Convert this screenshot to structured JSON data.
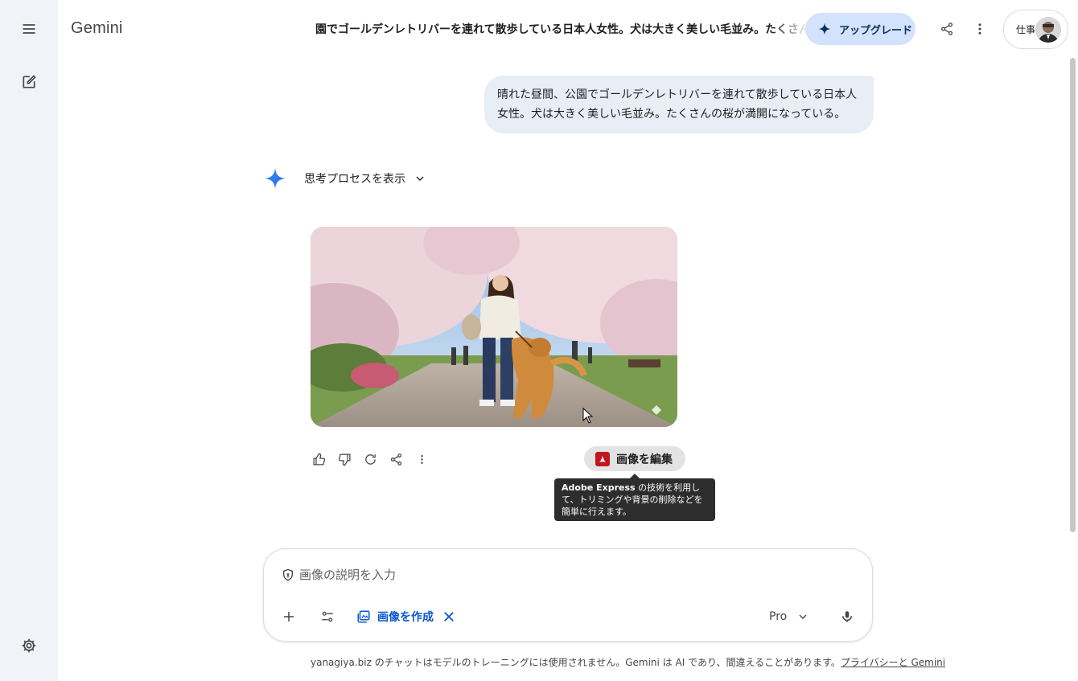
{
  "app": {
    "brand": "Gemini"
  },
  "header": {
    "conversation_title": "園でゴールデンレトリバーを連れて散歩している日本人女性。犬は大きく美しい毛並み。たくさんの桜",
    "upgrade_label": "アップグレード",
    "account_label": "仕事"
  },
  "sidebar": {
    "menu_icon": "hamburger-menu-icon",
    "new_chat_icon": "edit-note-icon",
    "settings_icon": "gear-icon"
  },
  "chat": {
    "user_message": "晴れた昼間、公園でゴールデンレトリバーを連れて散歩している日本人女性。犬は大きく美しい毛並み。たくさんの桜が満開になっている。",
    "thinking_label": "思考プロセスを表示",
    "edit_image_label": "画像を編集",
    "tooltip_brand": "Adobe Express",
    "tooltip_text": " の技術を利用して、トリミングや背景の削除などを簡単に行えます。"
  },
  "composer": {
    "placeholder": "画像の説明を入力",
    "chip_label": "画像を作成",
    "model_label": "Pro"
  },
  "footer": {
    "text": "yanagiya.biz のチャットはモデルのトレーニングには使用されません。Gemini は AI であり、間違えることがあります。",
    "link": "プライバシーと Gemini"
  },
  "colors": {
    "rail_bg": "#f0f4f9",
    "bubble_bg": "#e9eef6",
    "upgrade_bg": "#d3e3fd",
    "accent": "#0b57d0",
    "adobe_red": "#c4151c"
  }
}
